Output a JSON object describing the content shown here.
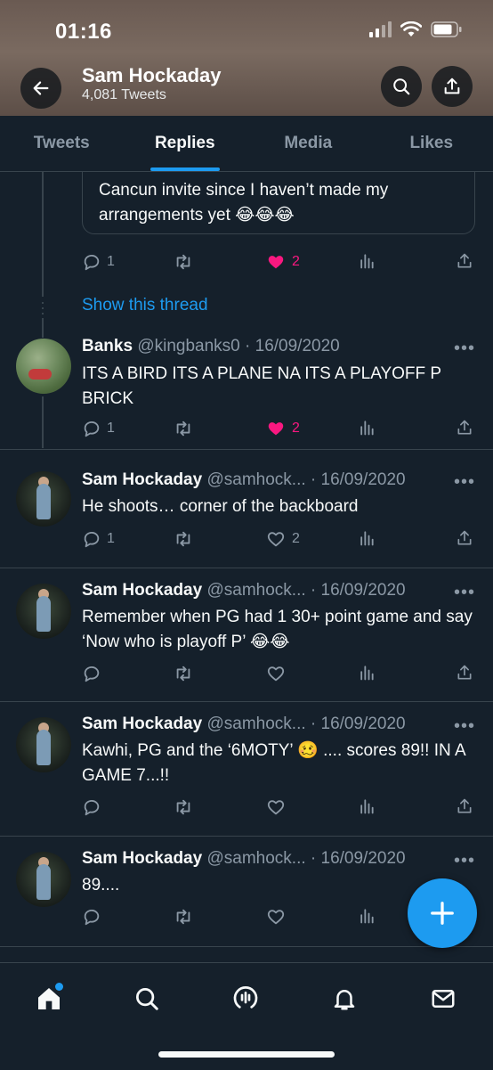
{
  "status_bar": {
    "time": "01:16"
  },
  "header": {
    "profile_name": "Sam Hockaday",
    "tweet_count": "4,081 Tweets"
  },
  "tabs": [
    {
      "label": "Tweets",
      "active": false
    },
    {
      "label": "Replies",
      "active": true
    },
    {
      "label": "Media",
      "active": false
    },
    {
      "label": "Likes",
      "active": false
    }
  ],
  "quoted_tweet": {
    "text": "Cancun invite since I haven’t made my arrangements yet 😂😂😂",
    "reply_count": "1",
    "like_count": "2",
    "liked": true
  },
  "show_thread_label": "Show this thread",
  "tweets": [
    {
      "name": "Banks",
      "handle": "@kingbanks0",
      "date": "16/09/2020",
      "text": "ITS A BIRD ITS A PLANE NA ITS A PLAYOFF P BRICK",
      "reply_count": "1",
      "like_count": "2",
      "liked": true
    },
    {
      "name": "Sam Hockaday",
      "handle": "@samhock...",
      "date": "16/09/2020",
      "text": "He shoots… corner of the backboard",
      "reply_count": "1",
      "like_count": "2",
      "liked": false
    },
    {
      "name": "Sam Hockaday",
      "handle": "@samhock...",
      "date": "16/09/2020",
      "text": "Remember when PG had 1 30+ point game and say ‘Now who is playoff P’ 😂😂",
      "reply_count": "",
      "like_count": "",
      "liked": false
    },
    {
      "name": "Sam Hockaday",
      "handle": "@samhock...",
      "date": "16/09/2020",
      "text": "Kawhi, PG and the ‘6MOTY’ 🥴 .... scores 89!! IN A GAME 7...!!",
      "reply_count": "",
      "like_count": "",
      "liked": false
    },
    {
      "name": "Sam Hockaday",
      "handle": "@samhock...",
      "date": "16/09/2020",
      "text": "89....",
      "reply_count": "",
      "like_count": "",
      "liked": false
    }
  ],
  "colors": {
    "background": "#15202b",
    "accent": "#1d9bf0",
    "like": "#f91880",
    "muted": "#8b98a5",
    "border": "#38444d"
  },
  "icons": [
    "back-arrow-icon",
    "search-icon",
    "share-icon",
    "reply-icon",
    "retweet-icon",
    "heart-icon",
    "views-icon",
    "more-icon",
    "compose-plus-icon",
    "home-icon",
    "spaces-icon",
    "bell-icon",
    "mail-icon"
  ]
}
